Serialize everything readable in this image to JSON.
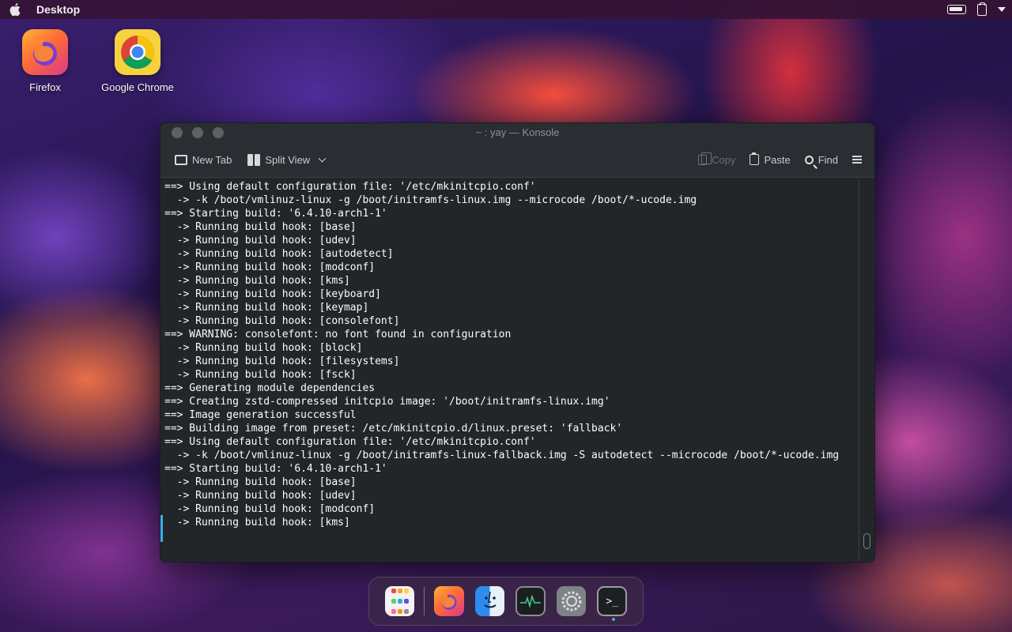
{
  "menubar": {
    "title": "Desktop"
  },
  "desktop_icons": [
    {
      "label": "Firefox"
    },
    {
      "label": "Google Chrome"
    }
  ],
  "window": {
    "title": "~ : yay — Konsole",
    "toolbar": {
      "new_tab": "New Tab",
      "split_view": "Split View",
      "copy": "Copy",
      "paste": "Paste",
      "find": "Find"
    },
    "terminal_lines": [
      "==> Using default configuration file: '/etc/mkinitcpio.conf'",
      "  -> -k /boot/vmlinuz-linux -g /boot/initramfs-linux.img --microcode /boot/*-ucode.img",
      "==> Starting build: '6.4.10-arch1-1'",
      "  -> Running build hook: [base]",
      "  -> Running build hook: [udev]",
      "  -> Running build hook: [autodetect]",
      "  -> Running build hook: [modconf]",
      "  -> Running build hook: [kms]",
      "  -> Running build hook: [keyboard]",
      "  -> Running build hook: [keymap]",
      "  -> Running build hook: [consolefont]",
      "==> WARNING: consolefont: no font found in configuration",
      "  -> Running build hook: [block]",
      "  -> Running build hook: [filesystems]",
      "  -> Running build hook: [fsck]",
      "==> Generating module dependencies",
      "==> Creating zstd-compressed initcpio image: '/boot/initramfs-linux.img'",
      "==> Image generation successful",
      "==> Building image from preset: /etc/mkinitcpio.d/linux.preset: 'fallback'",
      "==> Using default configuration file: '/etc/mkinitcpio.conf'",
      "  -> -k /boot/vmlinuz-linux -g /boot/initramfs-linux-fallback.img -S autodetect --microcode /boot/*-ucode.img",
      "==> Starting build: '6.4.10-arch1-1'",
      "  -> Running build hook: [base]",
      "  -> Running build hook: [udev]",
      "  -> Running build hook: [modconf]",
      "  -> Running build hook: [kms]"
    ]
  },
  "dock": {
    "items": [
      "launcher-icon",
      "firefox-icon",
      "finder-icon",
      "system-monitor-icon",
      "settings-icon",
      "terminal-icon"
    ],
    "terminal_glyph": ">_"
  },
  "colors": {
    "terminal_bg": "#232629",
    "terminal_fg": "#fcfcfc",
    "accent": "#3daee9"
  }
}
